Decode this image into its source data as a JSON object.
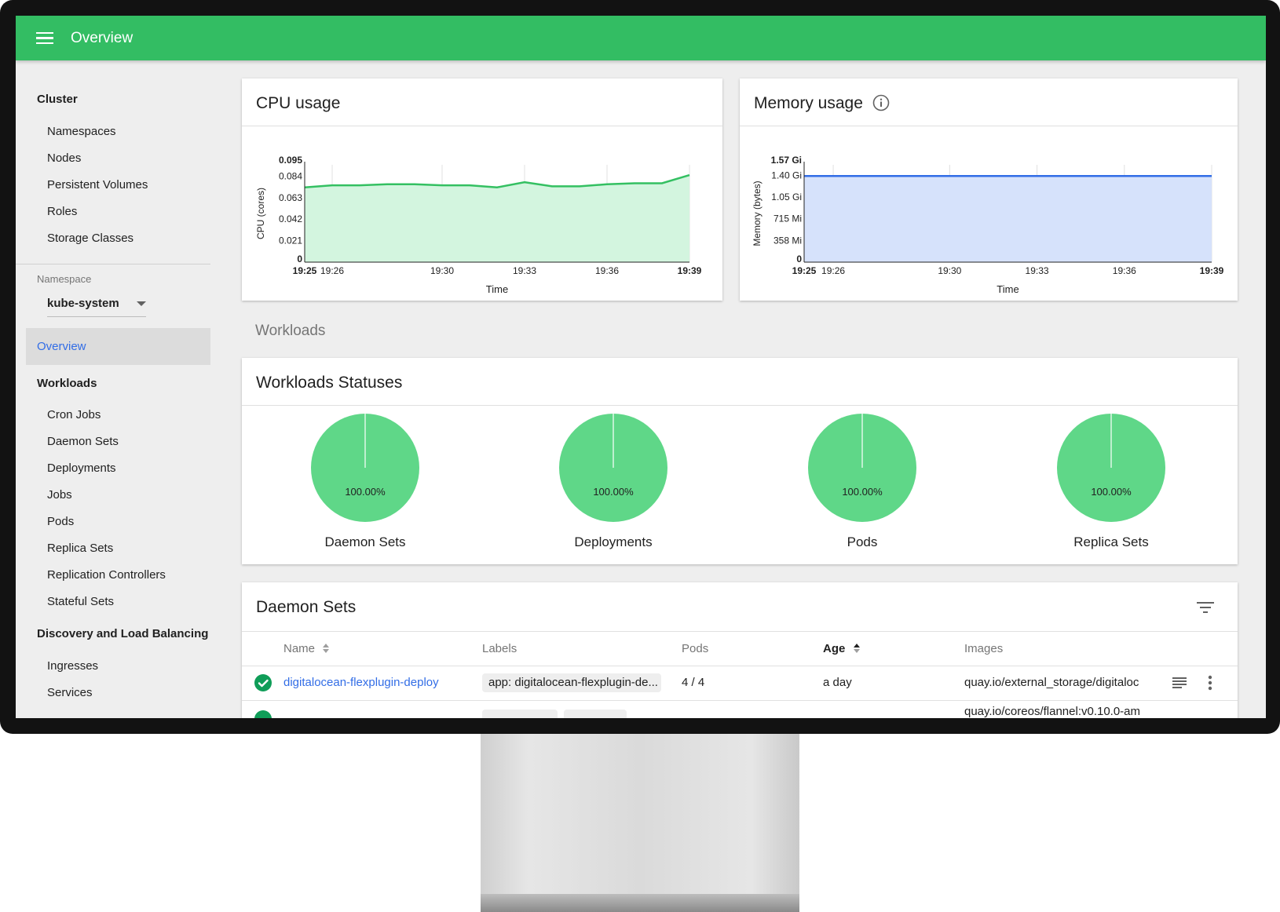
{
  "header": {
    "title": "Overview"
  },
  "sidebar": {
    "cluster_heading": "Cluster",
    "cluster_items": [
      "Namespaces",
      "Nodes",
      "Persistent Volumes",
      "Roles",
      "Storage Classes"
    ],
    "namespace_label": "Namespace",
    "namespace_value": "kube-system",
    "active_item": "Overview",
    "workloads_heading": "Workloads",
    "workload_items": [
      "Cron Jobs",
      "Daemon Sets",
      "Deployments",
      "Jobs",
      "Pods",
      "Replica Sets",
      "Replication Controllers",
      "Stateful Sets"
    ],
    "discovery_heading": "Discovery and Load Balancing",
    "discovery_items": [
      "Ingresses",
      "Services"
    ]
  },
  "cpu_card": {
    "title": "CPU usage"
  },
  "memory_card": {
    "title": "Memory usage"
  },
  "workloads_section": {
    "title": "Workloads"
  },
  "statuses_card": {
    "title": "Workloads Statuses",
    "pies": [
      {
        "label": "Daemon Sets",
        "percent": "100.00%"
      },
      {
        "label": "Deployments",
        "percent": "100.00%"
      },
      {
        "label": "Pods",
        "percent": "100.00%"
      },
      {
        "label": "Replica Sets",
        "percent": "100.00%"
      }
    ]
  },
  "daemon_sets_card": {
    "title": "Daemon Sets",
    "columns": {
      "name": "Name",
      "labels": "Labels",
      "pods": "Pods",
      "age": "Age",
      "images": "Images"
    },
    "rows": [
      {
        "name": "digitalocean-flexplugin-deploy",
        "label": "app: digitalocean-flexplugin-de...",
        "pods": "4 / 4",
        "age": "a day",
        "image": "quay.io/external_storage/digitaloc"
      },
      {
        "name": "",
        "label": "",
        "pods": "",
        "age": "",
        "image": "quay.io/coreos/flannel:v0.10.0-am"
      }
    ]
  },
  "chart_data": [
    {
      "type": "area",
      "xlabel": "Time",
      "ylabel": "CPU (cores)",
      "x": [
        "19:25",
        "19:26",
        "19:27",
        "19:28",
        "19:29",
        "19:30",
        "19:31",
        "19:32",
        "19:33",
        "19:34",
        "19:35",
        "19:36",
        "19:37",
        "19:38",
        "19:39"
      ],
      "x_ticks": [
        "19:25",
        "19:26",
        "19:30",
        "19:33",
        "19:36",
        "19:39"
      ],
      "x_ticks_bold": [
        "19:25",
        "19:39"
      ],
      "y_ticks": [
        "0",
        "0.021",
        "0.042",
        "0.063",
        "0.084",
        "0.095"
      ],
      "ylim": [
        0,
        0.095
      ],
      "series": [
        {
          "values": [
            0.073,
            0.075,
            0.075,
            0.076,
            0.076,
            0.075,
            0.075,
            0.073,
            0.078,
            0.074,
            0.074,
            0.076,
            0.077,
            0.077,
            0.085
          ]
        }
      ],
      "color": "#34c062",
      "fill": "#d3f5df"
    },
    {
      "type": "area",
      "xlabel": "Time",
      "ylabel": "Memory (bytes)",
      "x": [
        "19:25",
        "19:26",
        "19:27",
        "19:28",
        "19:29",
        "19:30",
        "19:31",
        "19:32",
        "19:33",
        "19:34",
        "19:35",
        "19:36",
        "19:37",
        "19:38",
        "19:39"
      ],
      "x_ticks": [
        "19:25",
        "19:26",
        "19:30",
        "19:33",
        "19:36",
        "19:39"
      ],
      "x_ticks_bold": [
        "19:25",
        "19:39"
      ],
      "y_ticks": [
        "0",
        "358 Mi",
        "715 Mi",
        "1.05 Gi",
        "1.40 Gi",
        "1.57 Gi"
      ],
      "y_values_gi": [
        0,
        0.35,
        0.7,
        1.05,
        1.4,
        1.57
      ],
      "ylim": [
        0,
        1.57
      ],
      "series": [
        {
          "values": [
            1.39,
            1.39,
            1.39,
            1.39,
            1.39,
            1.39,
            1.39,
            1.39,
            1.39,
            1.39,
            1.39,
            1.39,
            1.39,
            1.39,
            1.39
          ]
        }
      ],
      "color": "#326de6",
      "fill": "#d6e2fb"
    }
  ]
}
